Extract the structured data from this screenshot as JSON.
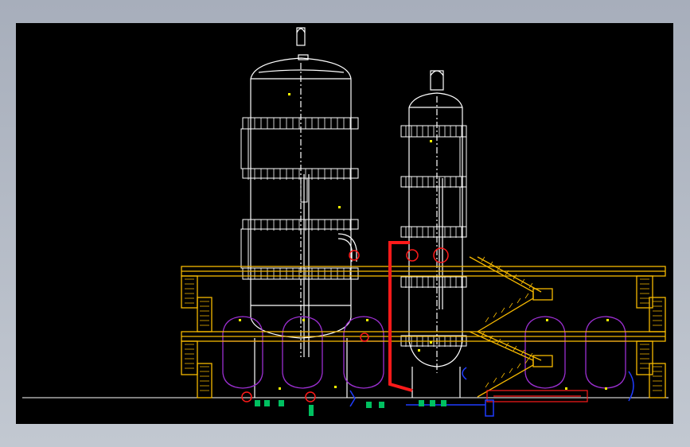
{
  "drawing": {
    "background": "#000000",
    "frame_color": "#b5bcc7",
    "colors": {
      "outline": "#ffffff",
      "platform": "#f5b800",
      "vessel": "#9b2fd0",
      "pipe": "#ff1a1a",
      "equipment_blue": "#1f3cff",
      "equipment_green": "#00c060",
      "marker": "#ffff00"
    },
    "elements": [
      "tall-column-left",
      "column-right",
      "yellow-platform-structure",
      "purple-storage-tanks",
      "red-piping",
      "stairs-right",
      "ladders-left",
      "horizontal-exchanger"
    ]
  }
}
